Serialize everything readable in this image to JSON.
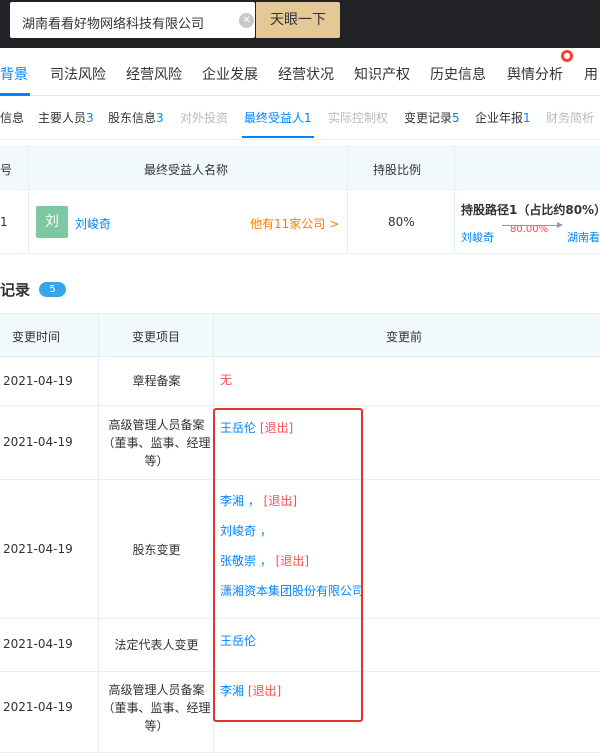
{
  "search": {
    "value": "湖南看看好物网络科技有限公司",
    "button": "天眼一下",
    "clear_icon": "clear-icon"
  },
  "main_nav": [
    {
      "label": "背景",
      "active": true
    },
    {
      "label": "司法风险"
    },
    {
      "label": "经营风险"
    },
    {
      "label": "企业发展"
    },
    {
      "label": "经营状况"
    },
    {
      "label": "知识产权"
    },
    {
      "label": "历史信息"
    },
    {
      "label": "舆情分析"
    },
    {
      "label": "用"
    }
  ],
  "sub_nav": [
    {
      "label": "信息",
      "count": ""
    },
    {
      "label": "主要人员",
      "count": "3"
    },
    {
      "label": "股东信息",
      "count": "3"
    },
    {
      "label": "对外投资",
      "count": ""
    },
    {
      "label": "最终受益人",
      "count": "1"
    },
    {
      "label": "实际控制权",
      "count": ""
    },
    {
      "label": "变更记录",
      "count": "5"
    },
    {
      "label": "企业年报",
      "count": "1"
    },
    {
      "label": "财务简析",
      "count": ""
    }
  ],
  "beneficiary": {
    "headers": [
      "号",
      "最终受益人名称",
      "持股比例"
    ],
    "row": {
      "index": "1",
      "avatar_char": "刘",
      "name": "刘峻奇",
      "companies": "他有11家公司 >",
      "ratio": "80%",
      "path_title": "持股路径1（占比约80%）",
      "path_from": "刘峻奇",
      "path_pct": "80.00%",
      "path_to": "湖南看"
    }
  },
  "change_section": {
    "title": "记录",
    "count": "5"
  },
  "change_table": {
    "headers": [
      "变更时间",
      "变更项目",
      "变更前"
    ],
    "rows": [
      {
        "date": "2021-04-19",
        "item": "章程备案",
        "before": [
          {
            "text": "无",
            "tag": ""
          }
        ]
      },
      {
        "date": "2021-04-19",
        "item": "高级管理人员备案（董事、监事、经理等）",
        "before": [
          {
            "text": "王岳伦",
            "tag": "[退出]"
          }
        ]
      },
      {
        "date": "2021-04-19",
        "item": "股东变更",
        "before": [
          {
            "text": "李湘 ，",
            "tag": "[退出]"
          },
          {
            "text": "刘峻奇 ，",
            "tag": ""
          },
          {
            "text": "张敬崇 ，",
            "tag": "[退出]"
          },
          {
            "text": "潇湘资本集团股份有限公司",
            "tag": ""
          }
        ]
      },
      {
        "date": "2021-04-19",
        "item": "法定代表人变更",
        "before": [
          {
            "text": "王岳伦",
            "tag": ""
          }
        ]
      },
      {
        "date": "2021-04-19",
        "item": "高级管理人员备案（董事、监事、经理等）",
        "before": [
          {
            "text": "李湘",
            "tag": "[退出]"
          }
        ]
      }
    ]
  },
  "colors": {
    "accent": "#0084ff",
    "warning": "#ff4d4f",
    "highlight_border": "#e5322e"
  }
}
